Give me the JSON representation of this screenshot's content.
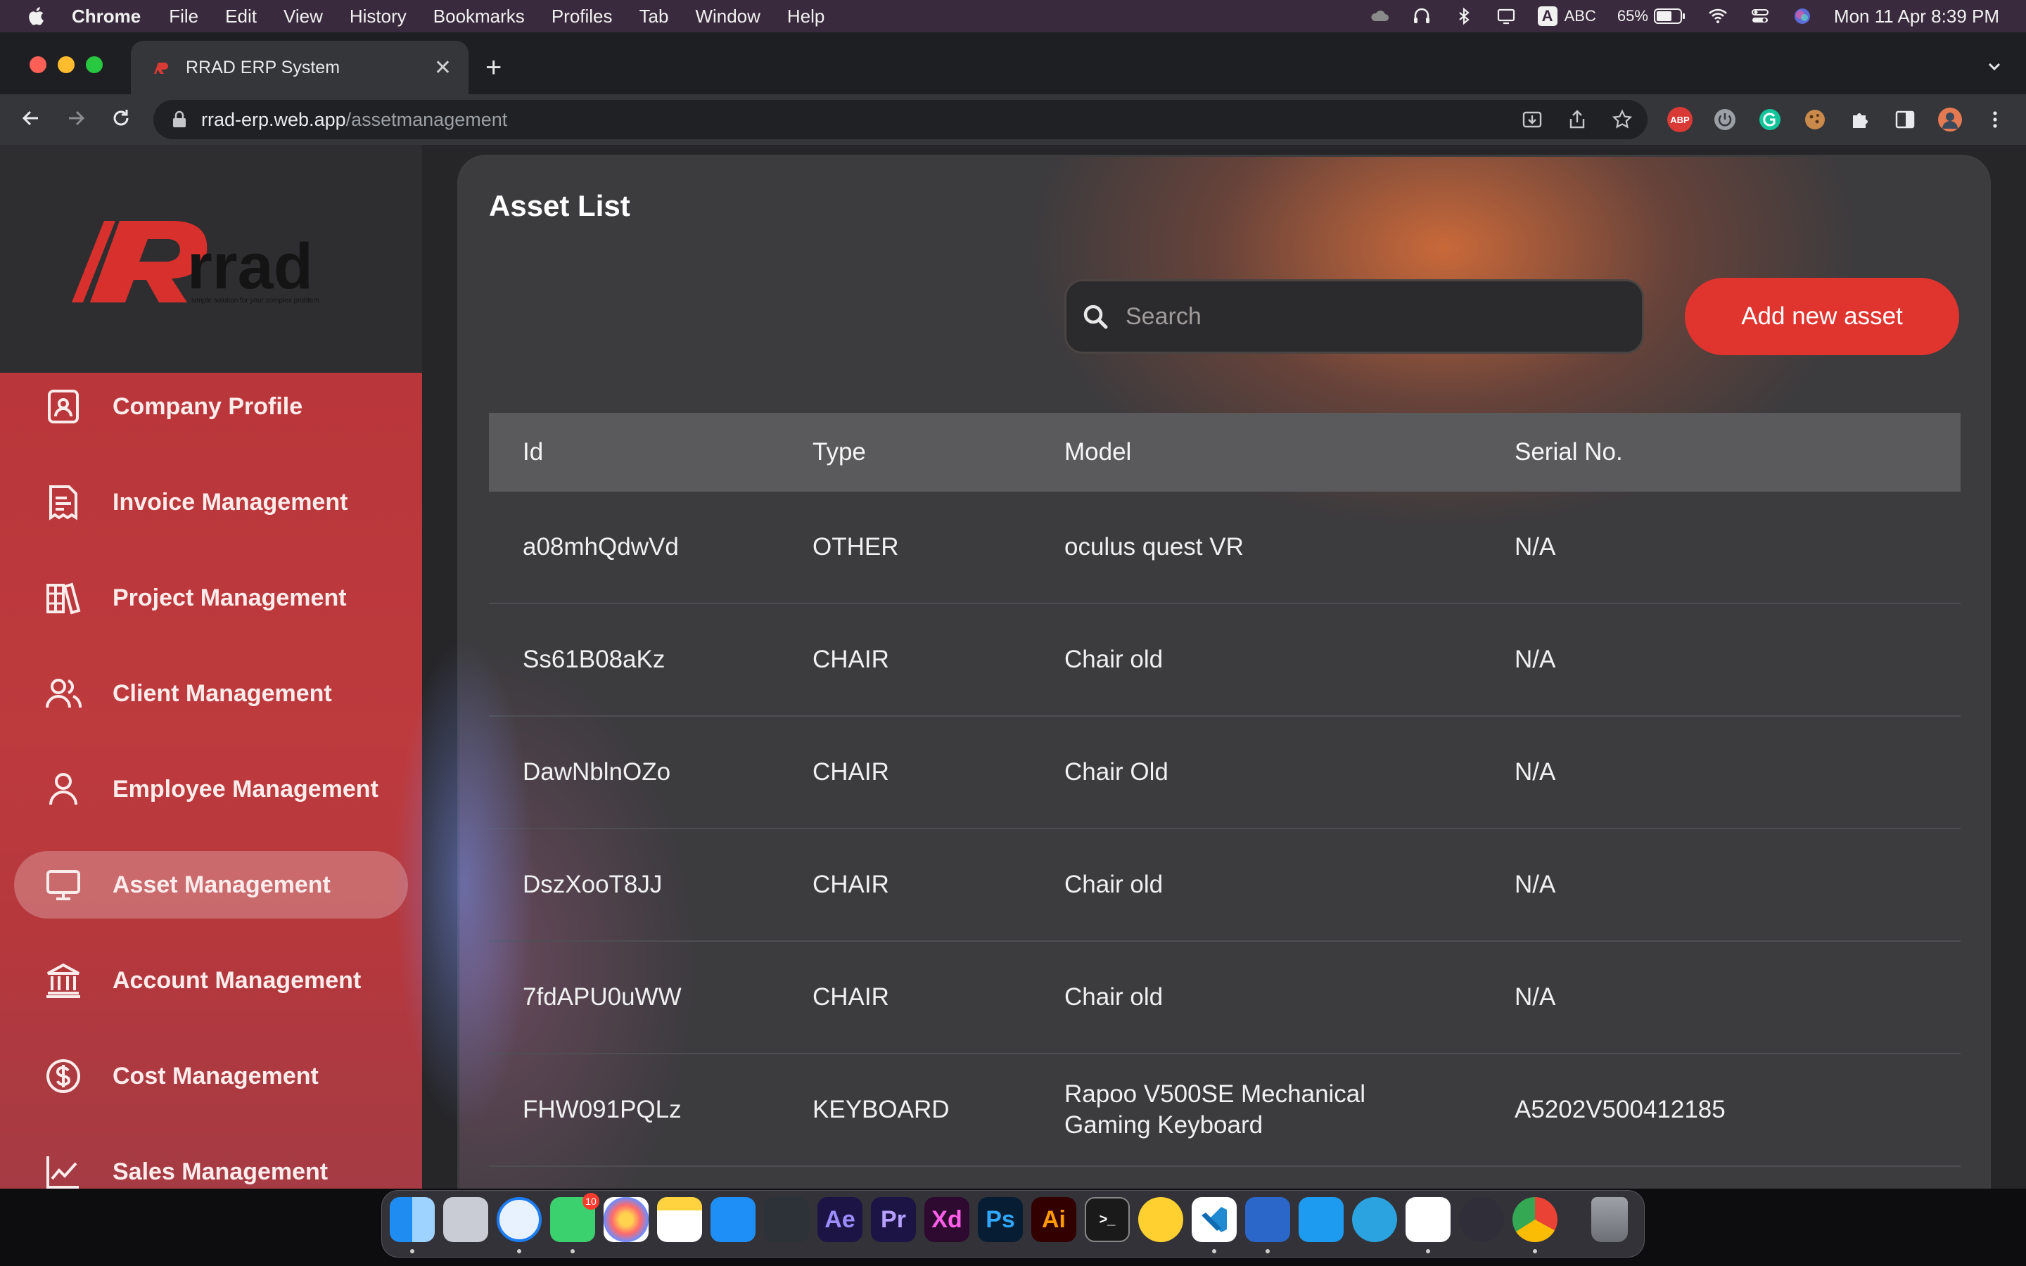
{
  "menubar": {
    "app_name": "Chrome",
    "items": [
      "File",
      "Edit",
      "View",
      "History",
      "Bookmarks",
      "Profiles",
      "Tab",
      "Window",
      "Help"
    ],
    "input_label": "ABC",
    "battery": "65%",
    "datetime": "Mon 11 Apr  8:39 PM"
  },
  "browser": {
    "tab_title": "RRAD ERP System",
    "url_domain": "rrad-erp.web.app",
    "url_path": "/assetmanagement",
    "new_tab_glyph": "+",
    "close_glyph": "✕"
  },
  "sidebar": {
    "logo_text": "rrad",
    "logo_tagline": "simple solution for your complex problem",
    "items": [
      {
        "label": "Company Profile",
        "icon": "id-card-icon"
      },
      {
        "label": "Invoice Management",
        "icon": "invoice-icon"
      },
      {
        "label": "Project Management",
        "icon": "books-icon"
      },
      {
        "label": "Client Management",
        "icon": "users-icon"
      },
      {
        "label": "Employee Management",
        "icon": "user-icon"
      },
      {
        "label": "Asset Management",
        "icon": "monitor-icon",
        "active": true
      },
      {
        "label": "Account Management",
        "icon": "bank-icon"
      },
      {
        "label": "Cost Management",
        "icon": "dollar-icon"
      },
      {
        "label": "Sales Management",
        "icon": "chart-icon"
      }
    ]
  },
  "main": {
    "title": "Asset List",
    "search_placeholder": "Search",
    "add_button": "Add new asset",
    "table": {
      "headers": [
        "Id",
        "Type",
        "Model",
        "Serial No."
      ],
      "rows": [
        [
          "a08mhQdwVd",
          "OTHER",
          "oculus quest VR",
          "N/A"
        ],
        [
          "Ss61B08aKz",
          "CHAIR",
          "Chair old",
          "N/A"
        ],
        [
          "DawNblnOZo",
          "CHAIR",
          "Chair Old",
          "N/A"
        ],
        [
          "DszXooT8JJ",
          "CHAIR",
          "Chair old",
          "N/A"
        ],
        [
          "7fdAPU0uWW",
          "CHAIR",
          "Chair old",
          "N/A"
        ],
        [
          "FHW091PQLz",
          "KEYBOARD",
          "Rapoo V500SE Mechanical Gaming Keyboard",
          "A5202V500412185"
        ]
      ]
    }
  },
  "dock": {
    "messages_badge": "10",
    "apps": [
      {
        "name": "finder",
        "label": ""
      },
      {
        "name": "launchpad",
        "label": ""
      },
      {
        "name": "safari",
        "label": ""
      },
      {
        "name": "messages",
        "label": ""
      },
      {
        "name": "photos",
        "label": ""
      },
      {
        "name": "notes",
        "label": ""
      },
      {
        "name": "app-store",
        "label": ""
      },
      {
        "name": "davinci-resolve",
        "label": ""
      },
      {
        "name": "after-effects",
        "label": "Ae"
      },
      {
        "name": "premiere-pro",
        "label": "Pr"
      },
      {
        "name": "xd",
        "label": "Xd"
      },
      {
        "name": "photoshop",
        "label": "Ps"
      },
      {
        "name": "illustrator",
        "label": "Ai"
      },
      {
        "name": "terminal",
        "label": ">_"
      },
      {
        "name": "miro",
        "label": ""
      },
      {
        "name": "vscode",
        "label": ""
      },
      {
        "name": "xcode-instruments",
        "label": ""
      },
      {
        "name": "xcode",
        "label": ""
      },
      {
        "name": "telegram",
        "label": ""
      },
      {
        "name": "slack",
        "label": ""
      },
      {
        "name": "obs",
        "label": ""
      },
      {
        "name": "chrome",
        "label": ""
      },
      {
        "name": "trash",
        "label": ""
      }
    ]
  }
}
